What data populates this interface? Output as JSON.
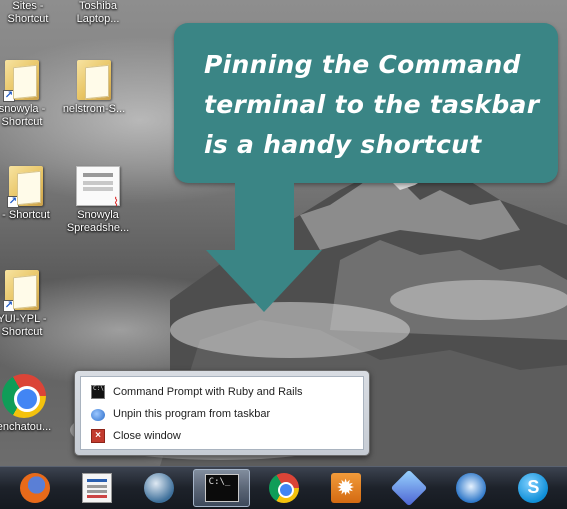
{
  "desktop": {
    "icons": [
      {
        "label_line1": "Sites -",
        "label_line2": "Shortcut",
        "icon": "folder-shortcut-icon"
      },
      {
        "label_line1": "Toshiba",
        "label_line2": "Laptop...",
        "icon": "document-icon"
      },
      {
        "label_line1": "snowyla -",
        "label_line2": "Shortcut",
        "icon": "folder-shortcut-icon"
      },
      {
        "label_line1": "nelstrom-S...",
        "label_line2": "",
        "icon": "folder-icon"
      },
      {
        "label_line1": "- Shortcut",
        "label_line2": "",
        "icon": "folder-shortcut-icon"
      },
      {
        "label_line1": "Snowyla",
        "label_line2": "Spreadshe...",
        "icon": "pdf-document-icon"
      },
      {
        "label_line1": "YUI-YPL -",
        "label_line2": "Shortcut",
        "icon": "folder-shortcut-icon"
      },
      {
        "label_line1": "enchatou...",
        "label_line2": "",
        "icon": "chrome-icon"
      }
    ]
  },
  "callout": {
    "text": "Pinning the Command terminal to the taskbar is a handy shortcut",
    "color": "#3a8585"
  },
  "jumplist": {
    "items": [
      {
        "label": "Command Prompt with Ruby and Rails",
        "icon": "command-prompt-icon"
      },
      {
        "label": "Unpin this program from taskbar",
        "icon": "unpin-icon"
      },
      {
        "label": "Close window",
        "icon": "close-window-icon"
      }
    ]
  },
  "taskbar": {
    "buttons": [
      {
        "name": "firefox",
        "icon": "firefox-icon",
        "active": false
      },
      {
        "name": "web-page",
        "icon": "web-page-icon",
        "active": false
      },
      {
        "name": "globe-app",
        "icon": "globe-icon",
        "active": false
      },
      {
        "name": "command-prompt",
        "icon": "command-prompt-icon",
        "active": true
      },
      {
        "name": "chrome",
        "icon": "chrome-icon",
        "active": false
      },
      {
        "name": "settings-app",
        "icon": "gear-icon",
        "active": false
      },
      {
        "name": "share-app",
        "icon": "share-icon",
        "active": false
      },
      {
        "name": "bird-app",
        "icon": "bird-icon",
        "active": false
      },
      {
        "name": "skype",
        "icon": "skype-icon",
        "active": false
      }
    ]
  }
}
